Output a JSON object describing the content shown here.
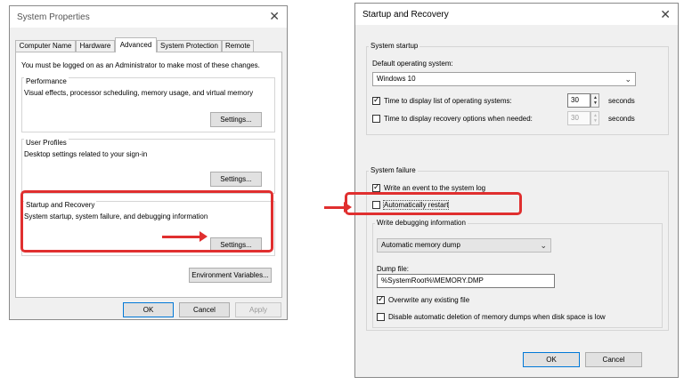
{
  "system_properties": {
    "title": "System Properties",
    "close": "✕",
    "tabs": [
      "Computer Name",
      "Hardware",
      "Advanced",
      "System Protection",
      "Remote"
    ],
    "notice": "You must be logged on as an Administrator to make most of these changes.",
    "performance": {
      "label": "Performance",
      "desc": "Visual effects, processor scheduling, memory usage, and virtual memory",
      "button": "Settings..."
    },
    "user_profiles": {
      "label": "User Profiles",
      "desc": "Desktop settings related to your sign-in",
      "button": "Settings..."
    },
    "startup_recovery": {
      "label": "Startup and Recovery",
      "desc": "System startup, system failure, and debugging information",
      "button": "Settings..."
    },
    "env_button": "Environment Variables...",
    "ok": "OK",
    "cancel": "Cancel",
    "apply": "Apply"
  },
  "startup_dialog": {
    "title": "Startup and Recovery",
    "close": "✕",
    "system_startup": {
      "label": "System startup",
      "default_os_label": "Default operating system:",
      "default_os_value": "Windows 10",
      "time_display_os": {
        "label": "Time to display list of operating systems:",
        "checked": true,
        "value": "30",
        "unit": "seconds"
      },
      "time_display_recovery": {
        "label": "Time to display recovery options when needed:",
        "checked": false,
        "value": "30",
        "unit": "seconds"
      }
    },
    "system_failure": {
      "label": "System failure",
      "write_event": {
        "label": "Write an event to the system log",
        "checked": true
      },
      "auto_restart": {
        "label": "Automatically restart",
        "checked": false
      },
      "debug_info": {
        "label": "Write debugging information",
        "dump_type": "Automatic memory dump",
        "dump_file_label": "Dump file:",
        "dump_file_value": "%SystemRoot%\\MEMORY.DMP",
        "overwrite": {
          "label": "Overwrite any existing file",
          "checked": true
        },
        "disable_auto_delete": {
          "label": "Disable automatic deletion of memory dumps when disk space is low",
          "checked": false
        }
      }
    },
    "ok": "OK",
    "cancel": "Cancel"
  },
  "colors": {
    "highlight": "#e02f2f",
    "accent": "#0078d7"
  }
}
